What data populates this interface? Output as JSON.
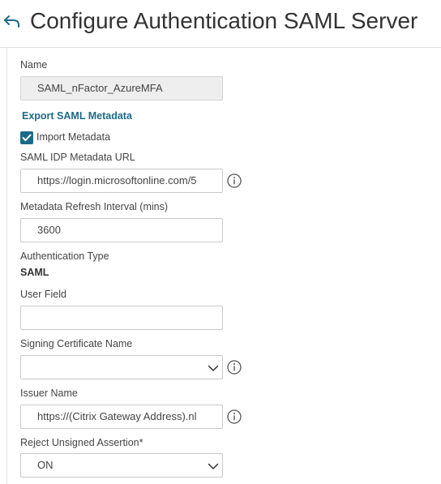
{
  "header": {
    "back_icon": "back-arrow-icon",
    "title": "Configure Authentication SAML Server"
  },
  "form": {
    "name_label": "Name",
    "name_value": "SAML_nFactor_AzureMFA",
    "export_link": "Export SAML Metadata",
    "import_metadata_label": "Import Metadata",
    "import_metadata_checked": true,
    "idp_metadata_url_label": "SAML IDP Metadata URL",
    "idp_metadata_url_value": "https://login.microsoftonline.com/5",
    "refresh_interval_label": "Metadata Refresh Interval (mins)",
    "refresh_interval_value": "3600",
    "auth_type_label": "Authentication Type",
    "auth_type_value": "SAML",
    "user_field_label": "User Field",
    "user_field_value": "",
    "signing_cert_label": "Signing Certificate Name",
    "signing_cert_value": "",
    "issuer_name_label": "Issuer Name",
    "issuer_name_value": "https://(Citrix Gateway Address).nl",
    "reject_unsigned_label": "Reject Unsigned Assertion*",
    "reject_unsigned_value": "ON"
  },
  "colors": {
    "accent": "#1b6a8a",
    "text": "#333333",
    "border": "#c9c9c9"
  }
}
